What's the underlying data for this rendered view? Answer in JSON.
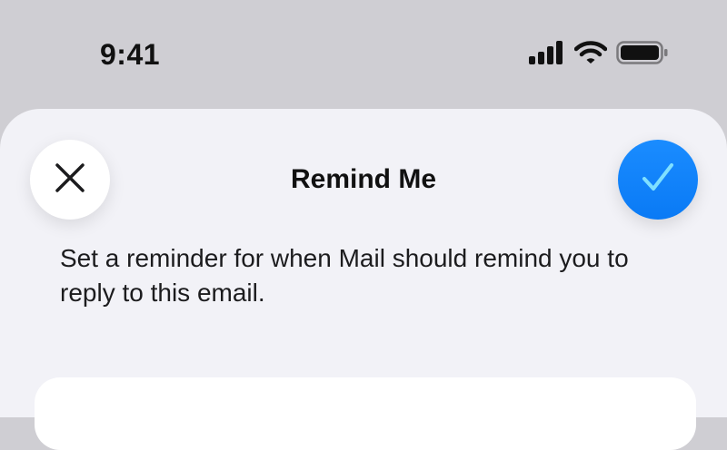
{
  "status_bar": {
    "time": "9:41",
    "icons": [
      "cellular-signal-icon",
      "wifi-icon",
      "battery-icon"
    ]
  },
  "sheet": {
    "title": "Remind Me",
    "description": "Set a reminder for when Mail should remind you to reply to this email.",
    "close_icon": "close-icon",
    "confirm_icon": "checkmark-icon",
    "accent_color": "#0a84ff"
  }
}
